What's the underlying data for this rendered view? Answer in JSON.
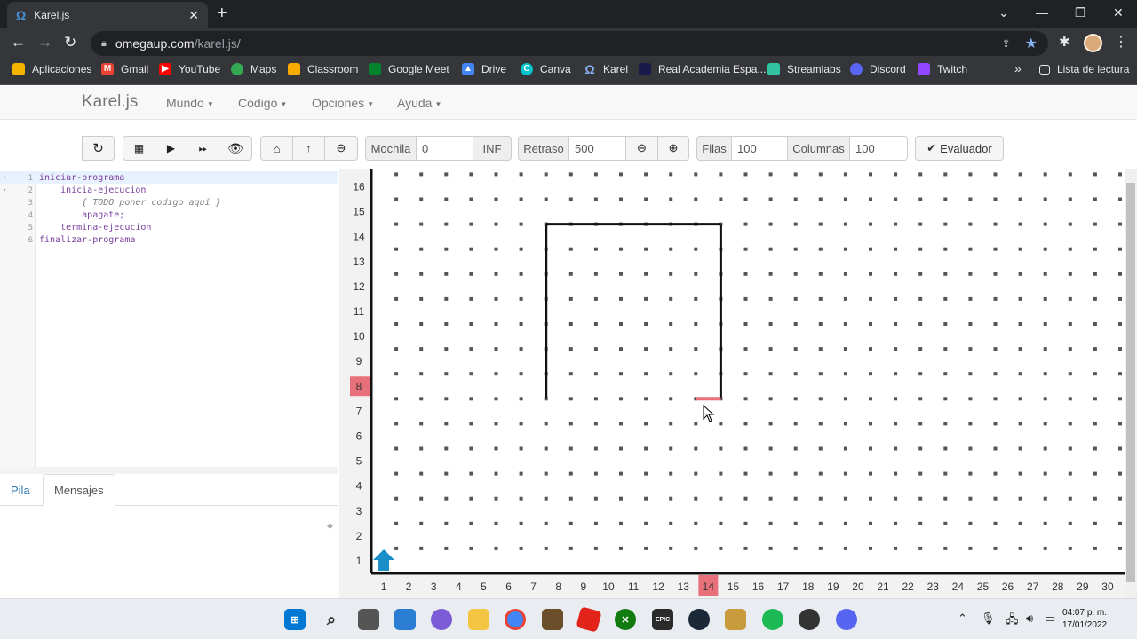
{
  "browser": {
    "tab_title": "Karel.js",
    "tab_favicon": "Ω",
    "url_host": "omegaup.com",
    "url_path": "/karel.js/",
    "bookmarks": [
      {
        "label": "Aplicaciones",
        "icon": "apps-grid-icon",
        "color": "#f4b400"
      },
      {
        "label": "Gmail",
        "icon": "gmail-icon",
        "color": "#ea4335"
      },
      {
        "label": "YouTube",
        "icon": "youtube-icon",
        "color": "#ff0000"
      },
      {
        "label": "Maps",
        "icon": "maps-icon",
        "color": "#34a853"
      },
      {
        "label": "Classroom",
        "icon": "classroom-icon",
        "color": "#f9ab00"
      },
      {
        "label": "Google Meet",
        "icon": "meet-icon",
        "color": "#00832d"
      },
      {
        "label": "Drive",
        "icon": "drive-icon",
        "color": "#4285f4"
      },
      {
        "label": "Canva",
        "icon": "canva-icon",
        "color": "#00c4cc"
      },
      {
        "label": "Karel",
        "icon": "karel-icon",
        "color": "#4a90d9"
      },
      {
        "label": "Real Academia Espa...",
        "icon": "rae-icon",
        "color": "#1a1a4a"
      },
      {
        "label": "Streamlabs",
        "icon": "streamlabs-icon",
        "color": "#31c3a2"
      },
      {
        "label": "Discord",
        "icon": "discord-icon",
        "color": "#5865f2"
      },
      {
        "label": "Twitch",
        "icon": "twitch-icon",
        "color": "#9146ff"
      }
    ],
    "overflow_label": "»",
    "reading_list": "Lista de lectura"
  },
  "app": {
    "brand": "Karel.js",
    "menus": [
      "Mundo",
      "Código",
      "Opciones",
      "Ayuda"
    ]
  },
  "controls": {
    "mochila_label": "Mochila",
    "mochila_value": "0",
    "inf_label": "INF",
    "retraso_label": "Retraso",
    "retraso_value": "500",
    "filas_label": "Filas",
    "filas_value": "100",
    "columnas_label": "Columnas",
    "columnas_value": "100",
    "evaluador_label": "Evaluador"
  },
  "editor": {
    "lines": [
      {
        "n": "1",
        "text": "iniciar-programa",
        "style": "kw"
      },
      {
        "n": "2",
        "text": "    inicia-ejecucion",
        "style": "kw"
      },
      {
        "n": "3",
        "text": "        { TODO poner codigo aquí }",
        "style": "cm"
      },
      {
        "n": "4",
        "text": "        apagate;",
        "style": "kw"
      },
      {
        "n": "5",
        "text": "    termina-ejecucion",
        "style": "kw"
      },
      {
        "n": "6",
        "text": "finalizar-programa",
        "style": "kw"
      }
    ]
  },
  "bottom_tabs": [
    "Pila",
    "Mensajes"
  ],
  "world": {
    "rows": 16,
    "cols": 30,
    "highlight_row": 8,
    "highlight_col": 14,
    "karel": {
      "col": 1,
      "row": 1,
      "facing": "north"
    },
    "highlight_color": "#e8707a",
    "karel_color": "#1a8ec8"
  },
  "taskbar": {
    "time": "04:07 p. m.",
    "date": "17/01/2022"
  }
}
